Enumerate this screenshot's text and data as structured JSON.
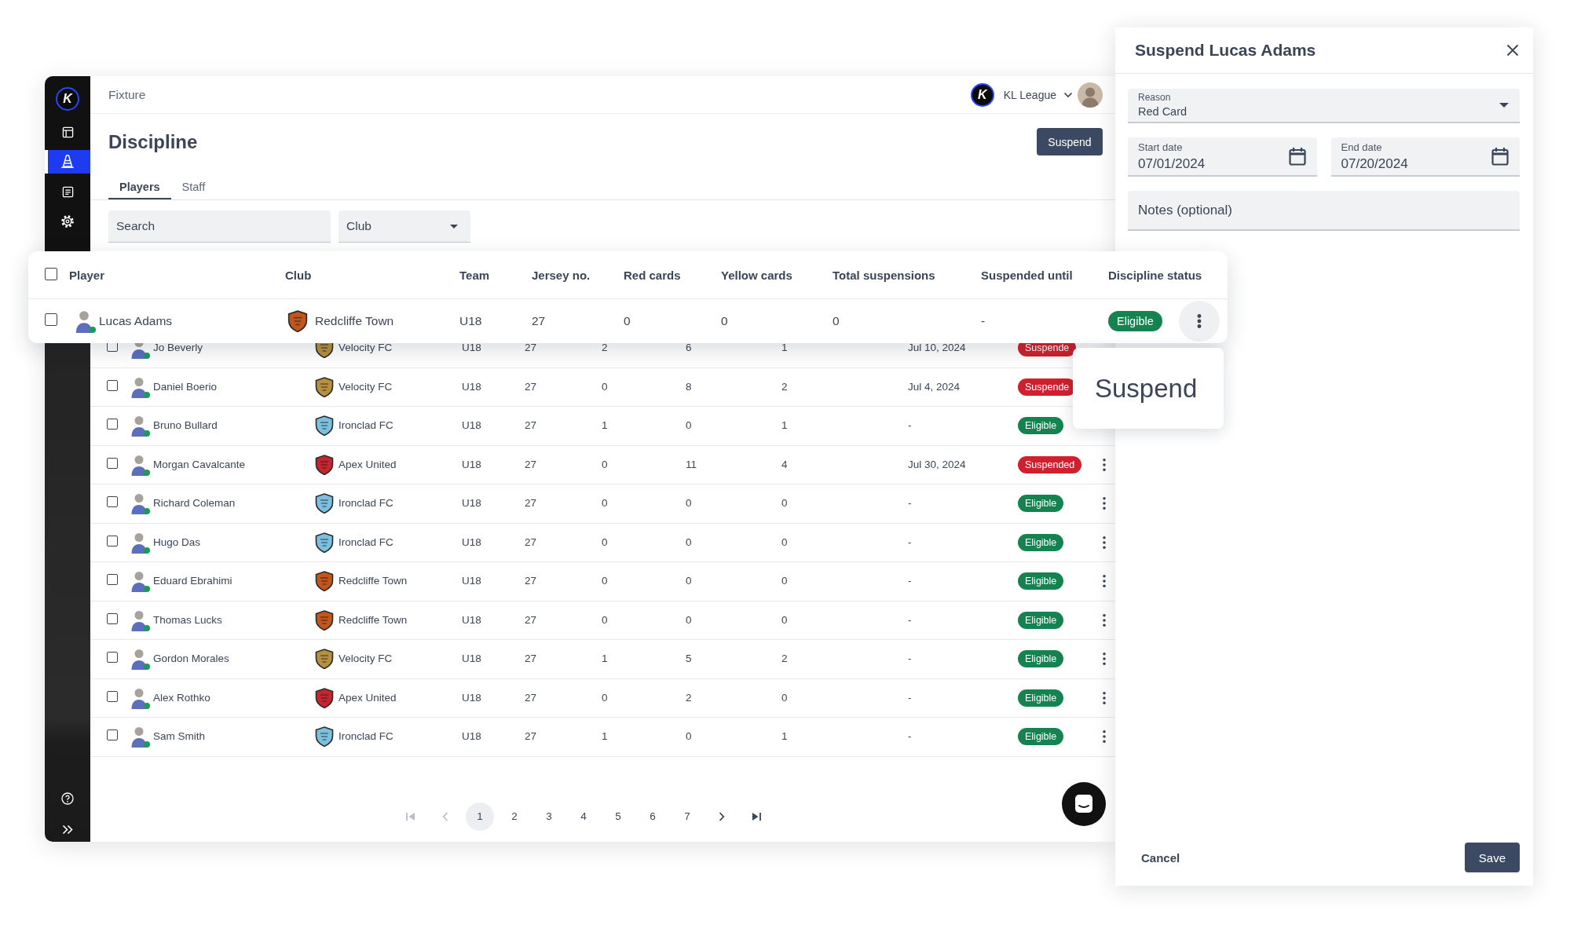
{
  "sidebar": {
    "logo": "K",
    "items": [
      {
        "kind": "layout",
        "selected": false
      },
      {
        "kind": "cone",
        "selected": true
      },
      {
        "kind": "document",
        "selected": false
      },
      {
        "kind": "settings",
        "selected": false
      }
    ]
  },
  "header": {
    "breadcrumb": "Fixture",
    "logo": "K",
    "league": "KL League"
  },
  "page": {
    "title": "Discipline",
    "action": "Suspend"
  },
  "tabs": [
    {
      "label": "Players",
      "selected": true
    },
    {
      "label": "Staff",
      "selected": false
    }
  ],
  "filters": {
    "search": {
      "placeholder": "Search"
    },
    "club": {
      "label": "Club"
    }
  },
  "focused_table": {
    "all_checked": false,
    "columns": [
      "Player",
      "Club",
      "Team",
      "Jersey no.",
      "Red cards",
      "Yellow cards",
      "Total suspensions",
      "Suspended until",
      "Discipline status"
    ],
    "row": {
      "checked": false,
      "player": "Lucas Adams",
      "club": {
        "name": "Redcliffe Town",
        "color": "#c2561c"
      },
      "team": "U18",
      "jersey": "27",
      "red_cards": "0",
      "yellow_cards": "0",
      "total_suspensions": "0",
      "suspended_until": "-",
      "status": {
        "label": "Eligible",
        "color": "#15834f"
      },
      "menu_open": true
    }
  },
  "table": {
    "rows": [
      {
        "checked": false,
        "player": "Jo Beverly",
        "club": {
          "name": "Velocity FC",
          "color": "#b5903f"
        },
        "team": "U18",
        "jersey": "27",
        "red_cards": "2",
        "yellow_cards": "6",
        "total_suspensions": "1",
        "suspended_until": "Jul 10, 2024",
        "status": {
          "label": "Suspende",
          "color": "#d0202e"
        },
        "menu": false
      },
      {
        "checked": false,
        "player": "Daniel Boerio",
        "club": {
          "name": "Velocity FC",
          "color": "#b5903f"
        },
        "team": "U18",
        "jersey": "27",
        "red_cards": "0",
        "yellow_cards": "8",
        "total_suspensions": "2",
        "suspended_until": "Jul 4, 2024",
        "status": {
          "label": "Suspende",
          "color": "#d0202e"
        },
        "menu": false
      },
      {
        "checked": false,
        "player": "Bruno Bullard",
        "club": {
          "name": "Ironclad FC",
          "color": "#7cc0e0"
        },
        "team": "U18",
        "jersey": "27",
        "red_cards": "1",
        "yellow_cards": "0",
        "total_suspensions": "1",
        "suspended_until": "-",
        "status": {
          "label": "Eligible",
          "color": "#15834f"
        },
        "menu": false
      },
      {
        "checked": false,
        "player": "Morgan Cavalcante",
        "club": {
          "name": "Apex United",
          "color": "#c62530"
        },
        "team": "U18",
        "jersey": "27",
        "red_cards": "0",
        "yellow_cards": "11",
        "total_suspensions": "4",
        "suspended_until": "Jul 30, 2024",
        "status": {
          "label": "Suspended",
          "color": "#d0202e"
        },
        "menu": true
      },
      {
        "checked": false,
        "player": "Richard Coleman",
        "club": {
          "name": "Ironclad FC",
          "color": "#7cc0e0"
        },
        "team": "U18",
        "jersey": "27",
        "red_cards": "0",
        "yellow_cards": "0",
        "total_suspensions": "0",
        "suspended_until": "-",
        "status": {
          "label": "Eligible",
          "color": "#15834f"
        },
        "menu": true
      },
      {
        "checked": false,
        "player": "Hugo Das",
        "club": {
          "name": "Ironclad FC",
          "color": "#7cc0e0"
        },
        "team": "U18",
        "jersey": "27",
        "red_cards": "0",
        "yellow_cards": "0",
        "total_suspensions": "0",
        "suspended_until": "-",
        "status": {
          "label": "Eligible",
          "color": "#15834f"
        },
        "menu": true
      },
      {
        "checked": false,
        "player": "Eduard Ebrahimi",
        "club": {
          "name": "Redcliffe Town",
          "color": "#c2561c"
        },
        "team": "U18",
        "jersey": "27",
        "red_cards": "0",
        "yellow_cards": "0",
        "total_suspensions": "0",
        "suspended_until": "-",
        "status": {
          "label": "Eligible",
          "color": "#15834f"
        },
        "menu": true
      },
      {
        "checked": false,
        "player": "Thomas Lucks",
        "club": {
          "name": "Redcliffe Town",
          "color": "#c2561c"
        },
        "team": "U18",
        "jersey": "27",
        "red_cards": "0",
        "yellow_cards": "0",
        "total_suspensions": "0",
        "suspended_until": "-",
        "status": {
          "label": "Eligible",
          "color": "#15834f"
        },
        "menu": true
      },
      {
        "checked": false,
        "player": "Gordon Morales",
        "club": {
          "name": "Velocity FC",
          "color": "#b5903f"
        },
        "team": "U18",
        "jersey": "27",
        "red_cards": "1",
        "yellow_cards": "5",
        "total_suspensions": "2",
        "suspended_until": "-",
        "status": {
          "label": "Eligible",
          "color": "#15834f"
        },
        "menu": true
      },
      {
        "checked": false,
        "player": "Alex Rothko",
        "club": {
          "name": "Apex United",
          "color": "#c62530"
        },
        "team": "U18",
        "jersey": "27",
        "red_cards": "0",
        "yellow_cards": "2",
        "total_suspensions": "0",
        "suspended_until": "-",
        "status": {
          "label": "Eligible",
          "color": "#15834f"
        },
        "menu": true
      },
      {
        "checked": false,
        "player": "Sam Smith",
        "club": {
          "name": "Ironclad FC",
          "color": "#7cc0e0"
        },
        "team": "U18",
        "jersey": "27",
        "red_cards": "1",
        "yellow_cards": "0",
        "total_suspensions": "1",
        "suspended_until": "-",
        "status": {
          "label": "Eligible",
          "color": "#15834f"
        },
        "menu": true
      }
    ]
  },
  "row_menu": {
    "items": [
      "Suspend"
    ]
  },
  "pagination": {
    "first": {
      "disabled": true
    },
    "previous": {
      "disabled": true
    },
    "pages": [
      {
        "label": "1",
        "selected": true
      },
      {
        "label": "2",
        "selected": false
      },
      {
        "label": "3",
        "selected": false
      },
      {
        "label": "4",
        "selected": false
      },
      {
        "label": "5",
        "selected": false
      },
      {
        "label": "6",
        "selected": false
      },
      {
        "label": "7",
        "selected": false
      }
    ],
    "next": {
      "disabled": false
    },
    "last": {
      "disabled": false
    }
  },
  "panel": {
    "title": "Suspend Lucas Adams",
    "reason": {
      "label": "Reason",
      "value": "Red Card"
    },
    "start_date": {
      "label": "Start date",
      "value": "07/01/2024"
    },
    "end_date": {
      "label": "End date",
      "value": "07/20/2024"
    },
    "notes": {
      "placeholder": "Notes (optional)"
    },
    "buttons": [
      {
        "label": "Cancel",
        "kind": "text"
      },
      {
        "label": "Save",
        "kind": "primary"
      }
    ]
  }
}
